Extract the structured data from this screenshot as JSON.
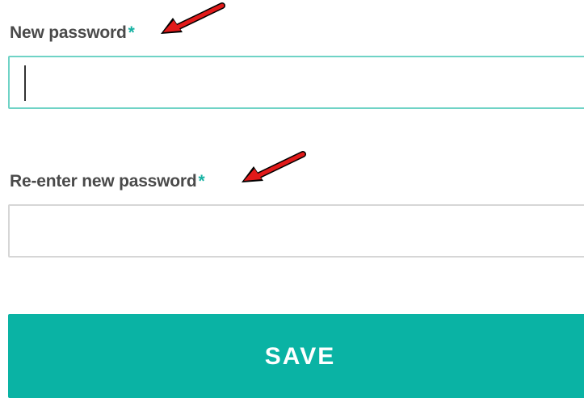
{
  "form": {
    "new_password": {
      "label": "New password",
      "required_marker": "*",
      "value": ""
    },
    "reenter_password": {
      "label": "Re-enter new password",
      "required_marker": "*",
      "value": ""
    },
    "save_label": "SAVE"
  },
  "colors": {
    "accent": "#0ab3a4",
    "required_marker": "#17b2a3",
    "focused_border": "#6fd3c6",
    "annotation_arrow": "#e21a1a"
  },
  "icons": {
    "annotation": "red-arrow-icon"
  }
}
